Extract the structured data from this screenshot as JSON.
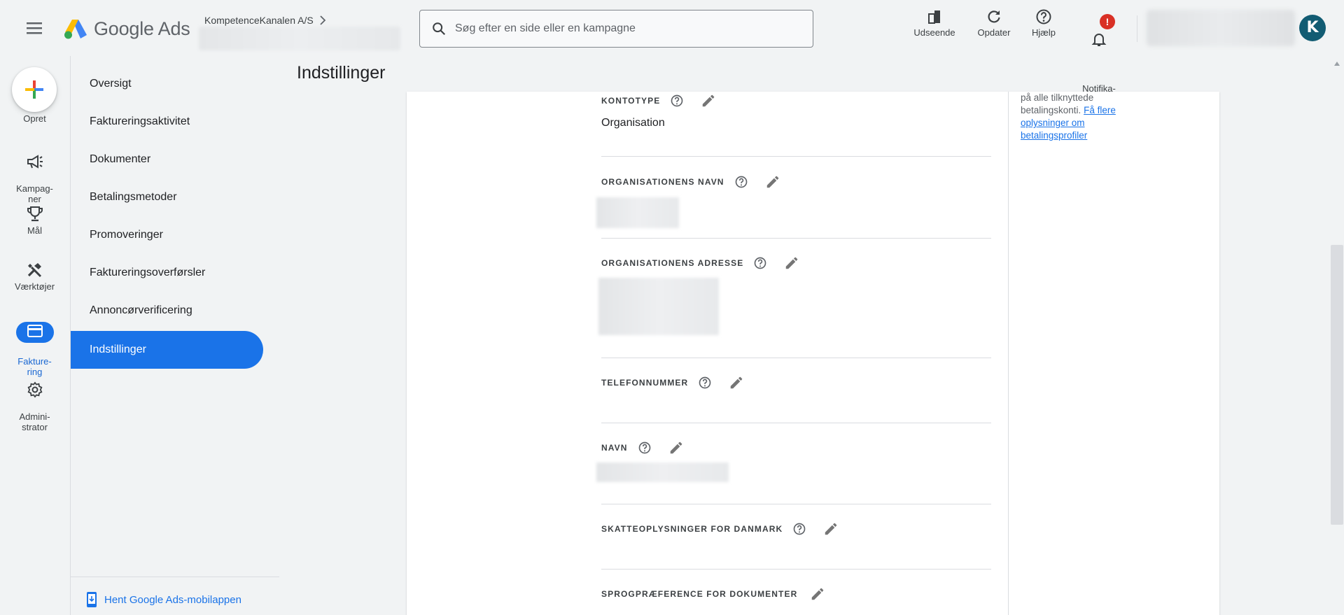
{
  "header": {
    "logo_text": "Google Ads",
    "account_name": "KompetenceKanalen A/S",
    "search_placeholder": "Søg efter en side eller en kampagne",
    "tools": [
      {
        "label": "Udseende",
        "icon": "appearance-icon"
      },
      {
        "label": "Opdater",
        "icon": "refresh-icon"
      },
      {
        "label": "Hjælp",
        "icon": "help-icon"
      },
      {
        "label": "Notifika-\ntioner",
        "icon": "bell-icon",
        "badge": "!"
      }
    ],
    "avatar_initial": "K"
  },
  "rail": {
    "create_label": "Opret",
    "items": [
      {
        "label": "Kampag-\nner",
        "icon": "megaphone-icon"
      },
      {
        "label": "Mål",
        "icon": "trophy-icon"
      },
      {
        "label": "Værktøjer",
        "icon": "tools-icon"
      },
      {
        "label": "Fakture-\nring",
        "icon": "credit-card-icon",
        "active": true
      },
      {
        "label": "Admini-\nstrator",
        "icon": "gear-icon"
      }
    ]
  },
  "subnav": {
    "items": [
      {
        "label": "Oversigt"
      },
      {
        "label": "Faktureringsaktivitet"
      },
      {
        "label": "Dokumenter"
      },
      {
        "label": "Betalingsmetoder"
      },
      {
        "label": "Promoveringer"
      },
      {
        "label": "Faktureringsoverførsler"
      },
      {
        "label": "Annoncørverificering"
      },
      {
        "label": "Indstillinger",
        "active": true
      }
    ],
    "mobile_link": "Hent Google Ads-mobilappen"
  },
  "main": {
    "title": "Indstillinger",
    "fields": [
      {
        "label": "KONTOTYPE",
        "value": "Organisation"
      },
      {
        "label": "ORGANISATIONENS NAVN",
        "value": ""
      },
      {
        "label": "ORGANISATIONENS ADRESSE",
        "value": ""
      },
      {
        "label": "TELEFONNUMMER",
        "value": ""
      },
      {
        "label": "NAVN",
        "value": ""
      },
      {
        "label": "SKATTEOPLYSNINGER FOR DANMARK",
        "value": ""
      },
      {
        "label": "SPROGPRÆFERENCE FOR DOKUMENTER",
        "value": ""
      }
    ],
    "side_note": {
      "text": "på alle tilknyttede betalingskonti.",
      "link": "Få flere oplysninger om betalingsprofiler"
    }
  },
  "colors": {
    "accent": "#1a73e8",
    "active_text": "#1967d2",
    "badge": "#d93025",
    "background": "#f1f3f4",
    "avatar": "#125c73"
  }
}
